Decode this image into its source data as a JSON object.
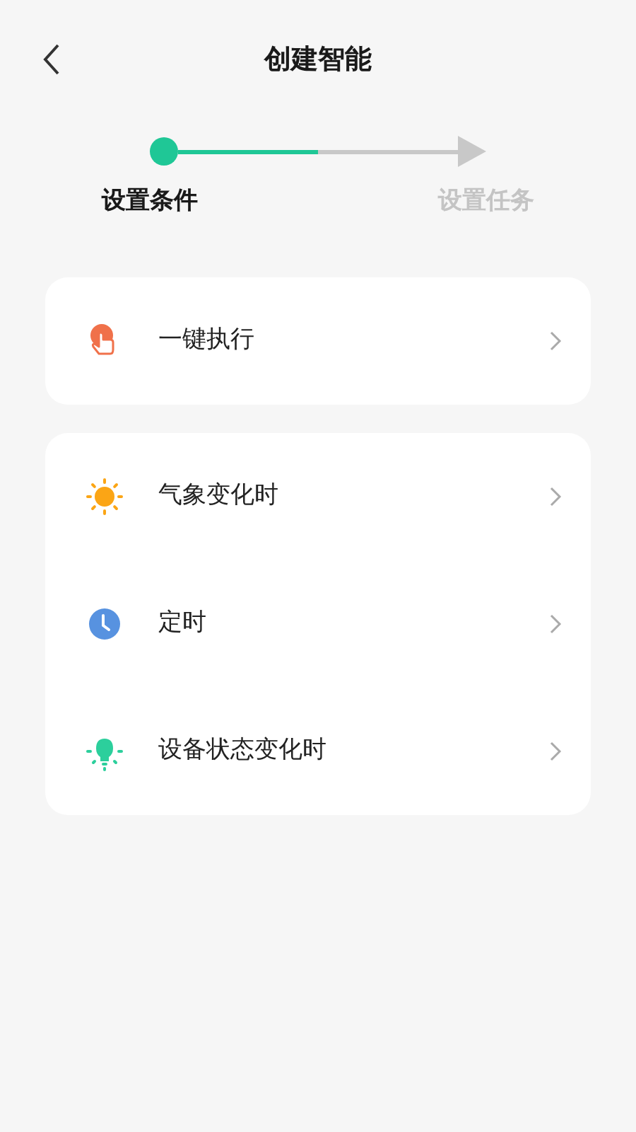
{
  "header": {
    "title": "创建智能"
  },
  "progress": {
    "level": 0.5
  },
  "steps": [
    {
      "label": "设置条件",
      "selected": true
    },
    {
      "label": "设置任务",
      "selected": false
    }
  ],
  "groups": [
    {
      "items": [
        {
          "kind": "tap",
          "label": "一键执行"
        }
      ]
    },
    {
      "items": [
        {
          "kind": "weather",
          "label": "气象变化时"
        },
        {
          "kind": "timer",
          "label": "定时"
        },
        {
          "kind": "device",
          "label": "设备状态变化时"
        }
      ]
    }
  ]
}
